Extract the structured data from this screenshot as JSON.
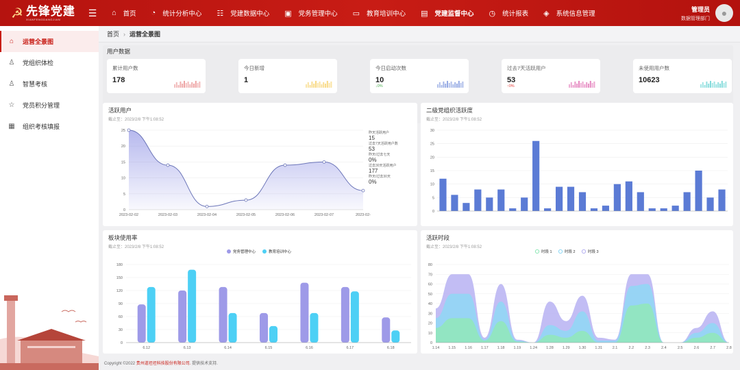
{
  "header": {
    "logo_title": "先锋党建",
    "logo_subtitle": "XIANFENGDANGJIAN",
    "nav": [
      {
        "label": "首页",
        "icon": "home-icon"
      },
      {
        "label": "统计分析中心",
        "icon": "pie-icon"
      },
      {
        "label": "党建数据中心",
        "icon": "database-icon"
      },
      {
        "label": "党务管理中心",
        "icon": "briefcase-icon"
      },
      {
        "label": "教育培训中心",
        "icon": "book-icon"
      },
      {
        "label": "党建监督中心",
        "icon": "monitor-icon"
      },
      {
        "label": "统计报表",
        "icon": "clock-icon"
      },
      {
        "label": "系统信息管理",
        "icon": "layers-icon"
      }
    ],
    "user_name": "管理员",
    "user_dept": "数据管理部门"
  },
  "sidebar": {
    "items": [
      {
        "label": "运营全景图",
        "icon": "home-icon"
      },
      {
        "label": "党组织体检",
        "icon": "user-check-icon"
      },
      {
        "label": "智慧考核",
        "icon": "user-check-icon"
      },
      {
        "label": "党员积分管理",
        "icon": "star-icon"
      },
      {
        "label": "组织考核填报",
        "icon": "report-icon"
      }
    ]
  },
  "breadcrumb": {
    "home": "首页",
    "current": "运营全景图"
  },
  "users": {
    "title": "用户数据",
    "cards": [
      {
        "label": "累计用户数",
        "value": "178",
        "pct": "",
        "color": "#e57373"
      },
      {
        "label": "今日新增",
        "value": "1",
        "pct": "",
        "color": "#f4c542"
      },
      {
        "label": "今日启动次数",
        "value": "10",
        "pct": "0%",
        "pct_prefix": "↓",
        "pct_color": "#4caf50",
        "color": "#5b7bd5"
      },
      {
        "label": "过去7天活跃用户",
        "value": "53",
        "pct": "0%",
        "pct_prefix": "↑",
        "pct_color": "#e53935",
        "color": "#d94aa0"
      },
      {
        "label": "未使用用户数",
        "value": "10623",
        "pct": "",
        "color": "#3fc7c7"
      }
    ]
  },
  "active_users": {
    "title": "活跃用户",
    "subtitle": "截止至：2023/2/8 下午1:08:52",
    "stats": [
      {
        "label": "昨天活跃用户",
        "value": "15"
      },
      {
        "label": "过去7天活跃用户数",
        "value": "53"
      },
      {
        "label": "昨天/过去七天",
        "value": "0%"
      },
      {
        "label": "过去30天活跃用户",
        "value": "177"
      },
      {
        "label": "昨天/过去30天",
        "value": "0%"
      }
    ]
  },
  "org_activity": {
    "title": "二级党组织活跃度",
    "subtitle": "截止至：2023/2/8 下午1:08:52"
  },
  "module_usage": {
    "title": "板块使用率",
    "subtitle": "截止至：2023/2/8 下午1:08:52"
  },
  "active_period": {
    "title": "活跃时段",
    "subtitle": "截止至：2023/2/8 下午1:08:52"
  },
  "footer": {
    "prefix": "Copyright ©2022",
    "company": "贵州道坦坦科技股份有限公司.",
    "suffix": "提供技术支持."
  },
  "chart_data": [
    {
      "type": "area",
      "x": [
        "2023-02-02",
        "2023-02-03",
        "2023-02-04",
        "2023-02-05",
        "2023-02-06",
        "2023-02-07",
        "2023-02-08"
      ],
      "x_tick_labels": [
        "2023-02-02",
        "2023-02-03",
        "2023-02-04",
        "2023-02-05",
        "2023-02-06",
        "2023-02-07",
        "2023-02-"
      ],
      "values": [
        25,
        14,
        1,
        3,
        14,
        15,
        6
      ],
      "ylim": [
        0,
        25
      ],
      "yticks": [
        0,
        5,
        10,
        15,
        20,
        25
      ],
      "color": "#7b7fe0"
    },
    {
      "type": "bar",
      "values": [
        12,
        6,
        3,
        8,
        5,
        8,
        1,
        5,
        26,
        1,
        9,
        9,
        7,
        1,
        2,
        10,
        11,
        7,
        1,
        1,
        2,
        7,
        15,
        5,
        8
      ],
      "ylim": [
        0,
        30
      ],
      "yticks": [
        0,
        5,
        10,
        15,
        20,
        25,
        30
      ],
      "color": "#5b7bd5"
    },
    {
      "type": "bar",
      "categories": [
        "6.12",
        "6.13",
        "6.14",
        "6.15",
        "6.16",
        "6.17",
        "6.18"
      ],
      "series": [
        {
          "name": "党务管理中心",
          "values": [
            88,
            120,
            128,
            68,
            138,
            128,
            58
          ],
          "color": "#9e9ae8"
        },
        {
          "name": "教育培训中心",
          "values": [
            128,
            168,
            68,
            38,
            68,
            118,
            28
          ],
          "color": "#4dd0f5"
        }
      ],
      "ylim": [
        0,
        180
      ],
      "yticks": [
        0,
        30,
        60,
        90,
        120,
        150,
        180
      ],
      "legend": "top-center"
    },
    {
      "type": "area",
      "x": [
        "1.14",
        "1.15",
        "1.16",
        "1.17",
        "1.18",
        "1.19",
        "1.24",
        "1.28",
        "1.29",
        "1.30",
        "1.31",
        "2.1",
        "2.2",
        "2.3",
        "2.4",
        "2.5",
        "2.6",
        "2.7",
        "2.8"
      ],
      "series": [
        {
          "name": "时段 1",
          "values": [
            15,
            25,
            25,
            2,
            22,
            1,
            0,
            8,
            5,
            12,
            0,
            0,
            38,
            40,
            0,
            0,
            5,
            10,
            0
          ],
          "color": "#90e8b8"
        },
        {
          "name": "时段 2",
          "values": [
            25,
            50,
            50,
            3,
            42,
            2,
            0,
            18,
            12,
            32,
            2,
            2,
            58,
            60,
            0,
            0,
            10,
            20,
            0
          ],
          "color": "#8fd8f5"
        },
        {
          "name": "时段 3",
          "values": [
            35,
            70,
            70,
            5,
            60,
            3,
            0,
            42,
            22,
            48,
            5,
            3,
            70,
            70,
            0,
            0,
            15,
            32,
            0
          ],
          "color": "#b7b2f2"
        }
      ],
      "ylim": [
        0,
        80
      ],
      "yticks": [
        0,
        10,
        20,
        30,
        40,
        50,
        60,
        70,
        80
      ],
      "legend": "top-center"
    }
  ]
}
